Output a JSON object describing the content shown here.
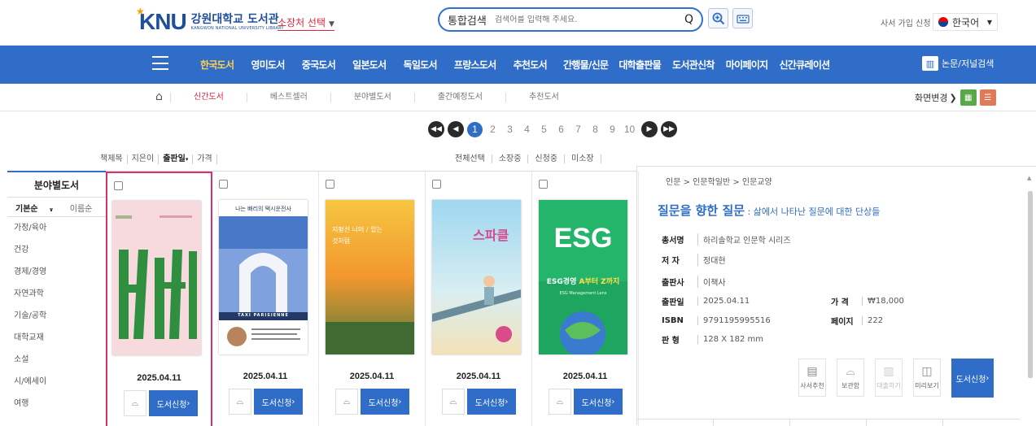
{
  "header": {
    "logo_text": "KNU",
    "logo_ko": "강원대학교 도서관",
    "logo_en": "KANGWON NATIONAL UNIVERSITY LIBRARY",
    "location_select": "소장처 선택",
    "search_label": "통합검색",
    "search_placeholder": "검색어를 입력해 주세요.",
    "search_icon": "magnifier",
    "signup_link": "사서 가입 신청",
    "language": "한국어"
  },
  "nav": {
    "items": [
      "한국도서",
      "영미도서",
      "중국도서",
      "일본도서",
      "독일도서",
      "프랑스도서",
      "추천도서",
      "간행물/신문",
      "대학출판물",
      "도서관신착",
      "마이페이지",
      "신간큐레이션"
    ],
    "active_index": 0,
    "journal_search": "논문/저널검색"
  },
  "subnav": {
    "items": [
      "신간도서",
      "베스트셀러",
      "분야별도서",
      "출간예정도서",
      "추천도서"
    ],
    "active_index": 0,
    "view_change": "화면변경"
  },
  "pagination": {
    "pages": [
      "1",
      "2",
      "3",
      "4",
      "5",
      "6",
      "7",
      "8",
      "9",
      "10"
    ],
    "current": "1"
  },
  "sort_tools": [
    "책제목",
    "지은이",
    "출판일",
    "가격"
  ],
  "filter_tools": [
    "전체선택",
    "소장중",
    "신청중",
    "미소장"
  ],
  "category": {
    "title": "분야별도서",
    "sort_basic": "기본순",
    "sort_name": "이름순",
    "items": [
      "가정/육아",
      "건강",
      "경제/경영",
      "자연과학",
      "기술/공학",
      "대학교재",
      "소설",
      "시/에세이",
      "여행"
    ]
  },
  "books": [
    {
      "date": "2025.04.11",
      "request": "도서신청",
      "cover": "green-stripes"
    },
    {
      "date": "2025.04.11",
      "request": "도서신청",
      "cover": "paris-arch"
    },
    {
      "date": "2025.04.11",
      "request": "도서신청",
      "cover": "sunset"
    },
    {
      "date": "2025.04.11",
      "request": "도서신청",
      "cover": "sky-girl"
    },
    {
      "date": "2025.04.11",
      "request": "도서신청",
      "cover": "esg-globe"
    }
  ],
  "cover_text": {
    "book2_title": "나는 빠리의 택시운전사",
    "book2_band": "TAXI PARISIENNE",
    "book3_title": "지평선 너머 / 있는 것처럼",
    "book4_title": "스파클",
    "book5_big": "ESG",
    "book5_title_a": "ESG경영 ",
    "book5_title_b": "A부터 Z까지",
    "book5_sub": "ESG Management Lens"
  },
  "detail": {
    "breadcrumb": "인문 > 인문학일반 > 인문교양",
    "title": "질문을 향한 질문",
    "subtitle": " : 삶에서 나타난 질문에 대한 단상들",
    "series_label": "총서명",
    "series": "하리솔학교 인문학 시리즈",
    "author_label": "저 자",
    "author": "정대현",
    "publisher_label": "출판사",
    "publisher": "이책사",
    "pubdate_label": "출판일",
    "pubdate": "2025.04.11",
    "price_label": "가 격",
    "price": "₩18,000",
    "isbn_label": "ISBN",
    "isbn": "9791195995516",
    "pages_label": "페이지",
    "pages": "222",
    "size_label": "판 형",
    "size": "128 X 182 mm",
    "buttons": [
      "사서추천",
      "보관함",
      "대출하기",
      "미리보기"
    ],
    "request": "도서신청"
  }
}
